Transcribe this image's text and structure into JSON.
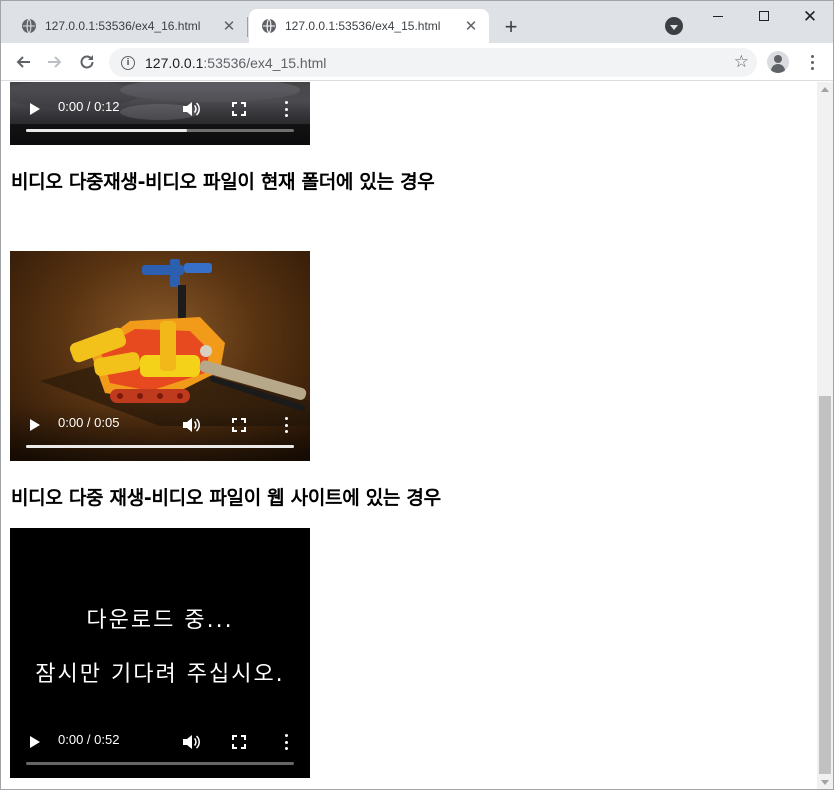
{
  "browser": {
    "tabs": [
      {
        "title": "127.0.0.1:53536/ex4_16.html",
        "active": false
      },
      {
        "title": "127.0.0.1:53536/ex4_15.html",
        "active": true
      }
    ],
    "url_host": "127.0.0.1",
    "url_rest": ":53536/ex4_15.html"
  },
  "content": {
    "heading1": "비디오 다중재생-비디오 파일이 현재 폴더에 있는 경우",
    "heading2": "비디오 다중 재생-비디오 파일이 웹 사이트에 있는 경우",
    "videos": [
      {
        "time": "0:00 / 0:12",
        "progress": 0.6
      },
      {
        "time": "0:00 / 0:05",
        "progress": 1.0
      },
      {
        "time": "0:00 / 0:52",
        "progress": 0.0,
        "loading_line1": "다운로드 중...",
        "loading_line2": "잠시만 기다려 주십시오."
      }
    ]
  },
  "colors": {
    "tabstrip": "#dee1e6",
    "omnibox": "#f1f3f4",
    "scroll_thumb": "#c1c1c1"
  }
}
